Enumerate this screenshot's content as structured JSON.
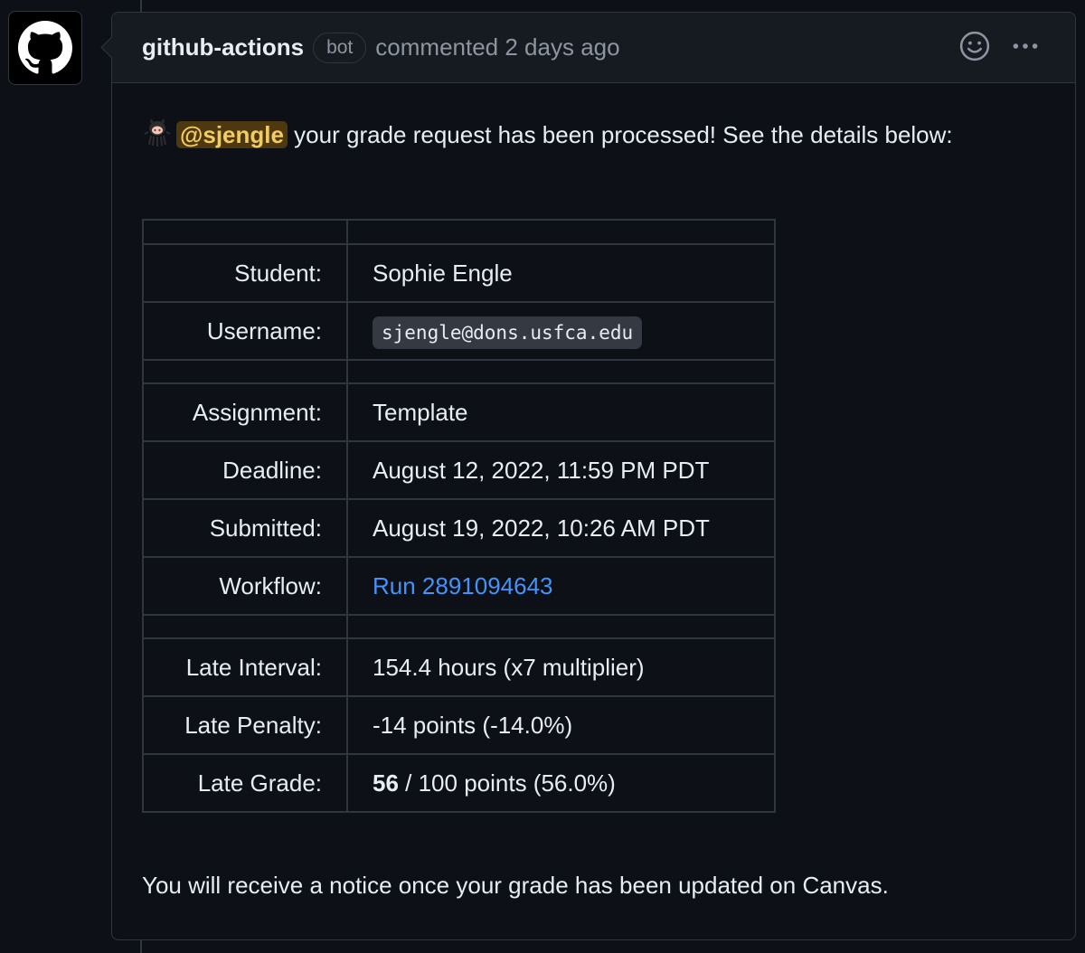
{
  "comment": {
    "author": "github-actions",
    "badge": "bot",
    "action": "commented",
    "time": "2 days ago",
    "avatar_icon": "github-octocat-icon",
    "reaction_icon": "smiley-icon",
    "menu_icon": "kebab-horizontal-icon"
  },
  "intro": {
    "emoji_icon": "octocat-emoji-icon",
    "mention": "@sjengle",
    "text": " your grade request has been processed! See the details below:"
  },
  "table": {
    "rows": [
      {
        "key": "Student:",
        "value": "Sophie Engle"
      },
      {
        "key": "Username:",
        "value": "sjengle@dons.usfca.edu"
      },
      {
        "key": "Assignment:",
        "value": "Template"
      },
      {
        "key": "Deadline:",
        "value": "August 12, 2022, 11:59 PM PDT"
      },
      {
        "key": "Submitted:",
        "value": "August 19, 2022, 10:26 AM PDT"
      },
      {
        "key": "Workflow:",
        "value": "Run 2891094643"
      },
      {
        "key": "Late Interval:",
        "value": "154.4 hours (x7 multiplier)"
      },
      {
        "key": "Late Penalty:",
        "value": "-14 points (-14.0%)"
      },
      {
        "key": "Late Grade:",
        "value_bold": "56",
        "value_rest": " / 100 points (56.0%)"
      }
    ]
  },
  "footer": "You will receive a notice once your grade has been updated on Canvas.",
  "colors": {
    "background": "#0d1117",
    "header": "#161b22",
    "border": "#30363d",
    "link": "#4493f8",
    "mention_bg": "#4d3810",
    "mention_fg": "#f2cc60"
  }
}
